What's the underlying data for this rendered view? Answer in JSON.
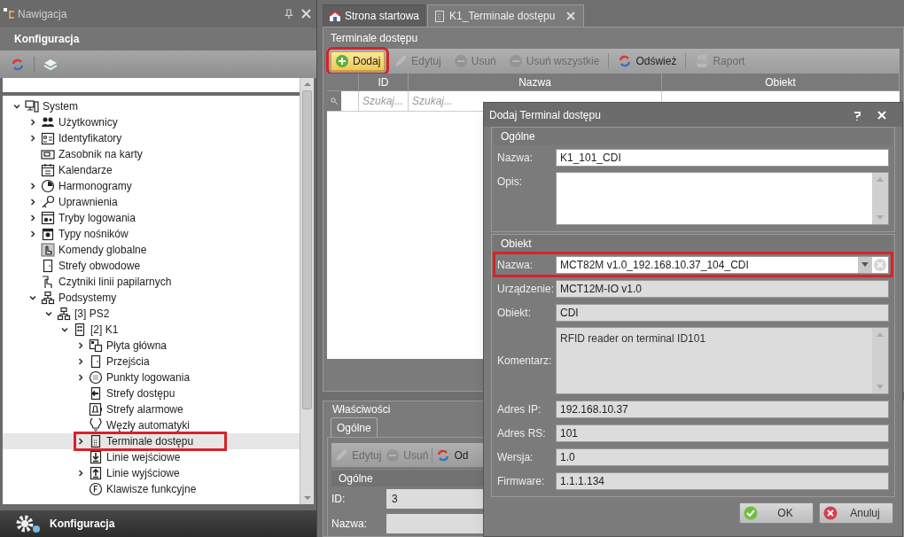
{
  "navigation": {
    "title": "Nawigacja",
    "section": "Konfiguracja",
    "tree": [
      {
        "label": "System",
        "expanded": true,
        "selected": false,
        "highlighted": false,
        "children": [
          {
            "label": "Użytkownicy",
            "expanded": false,
            "selected": false,
            "highlighted": false
          },
          {
            "label": "Identyfikatory",
            "expanded": false,
            "selected": false,
            "highlighted": false
          },
          {
            "label": "Zasobnik na karty",
            "selected": false,
            "highlighted": false
          },
          {
            "label": "Kalendarze",
            "selected": false,
            "highlighted": false
          },
          {
            "label": "Harmonogramy",
            "expanded": false,
            "selected": false,
            "highlighted": false
          },
          {
            "label": "Uprawnienia",
            "expanded": false,
            "selected": false,
            "highlighted": false
          },
          {
            "label": "Tryby logowania",
            "expanded": false,
            "selected": false,
            "highlighted": false
          },
          {
            "label": "Typy nośników",
            "expanded": false,
            "selected": false,
            "highlighted": false
          },
          {
            "label": "Komendy globalne",
            "selected": false,
            "highlighted": false
          },
          {
            "label": "Strefy obwodowe",
            "selected": false,
            "highlighted": false
          },
          {
            "label": "Czytniki linii papilarnych",
            "selected": false,
            "highlighted": false
          },
          {
            "label": "Podsystemy",
            "expanded": true,
            "selected": false,
            "highlighted": false,
            "children": [
              {
                "label": "[3] PS2",
                "expanded": true,
                "selected": false,
                "highlighted": false,
                "children": [
                  {
                    "label": "[2] K1",
                    "expanded": true,
                    "selected": false,
                    "highlighted": false,
                    "children": [
                      {
                        "label": "Płyta główna",
                        "expanded": false,
                        "selected": false,
                        "highlighted": false
                      },
                      {
                        "label": "Przejścia",
                        "expanded": false,
                        "selected": false,
                        "highlighted": false
                      },
                      {
                        "label": "Punkty logowania",
                        "expanded": false,
                        "selected": false,
                        "highlighted": false
                      },
                      {
                        "label": "Strefy dostępu",
                        "selected": false,
                        "highlighted": false
                      },
                      {
                        "label": "Strefy alarmowe",
                        "selected": false,
                        "highlighted": false
                      },
                      {
                        "label": "Węzły automatyki",
                        "selected": false,
                        "highlighted": false
                      },
                      {
                        "label": "Terminale dostępu",
                        "expanded": false,
                        "selected": true,
                        "highlighted": true
                      },
                      {
                        "label": "Linie wejściowe",
                        "selected": false,
                        "highlighted": false
                      },
                      {
                        "label": "Linie wyjściowe",
                        "expanded": false,
                        "selected": false,
                        "highlighted": false
                      },
                      {
                        "label": "Klawisze funkcyjne",
                        "selected": false,
                        "highlighted": false
                      }
                    ]
                  }
                ]
              }
            ]
          }
        ]
      }
    ],
    "footer": "Konfiguracja"
  },
  "tabs": [
    {
      "label": "Strona startowa",
      "selected": false,
      "closable": false
    },
    {
      "label": "K1_Terminale dostępu",
      "selected": true,
      "closable": true
    }
  ],
  "list_panel": {
    "title": "Terminale dostępu",
    "toolbar": [
      {
        "label": "Dodaj",
        "kind": "add",
        "disabled": false,
        "highlighted": true
      },
      {
        "label": "Edytuj",
        "kind": "edit",
        "disabled": true,
        "highlighted": false
      },
      {
        "label": "Usuń",
        "kind": "remove",
        "disabled": true,
        "highlighted": false
      },
      {
        "label": "Usuń wszystkie",
        "kind": "remove",
        "disabled": true,
        "highlighted": false
      },
      {
        "label": "Odśwież",
        "kind": "refresh",
        "disabled": false,
        "highlighted": false
      },
      {
        "label": "Raport",
        "kind": "report",
        "disabled": true,
        "highlighted": false
      }
    ],
    "columns": [
      "ID",
      "Nazwa",
      "Obiekt"
    ],
    "search_placeholders": [
      "Szukaj...",
      "Szukaj..."
    ]
  },
  "properties_panel": {
    "title": "Właściwości",
    "tabs": [
      {
        "label": "Ogólne",
        "selected": true
      }
    ],
    "toolbar": [
      {
        "label": "Edytuj",
        "kind": "edit",
        "disabled": true
      },
      {
        "label": "Usuń",
        "kind": "remove",
        "disabled": true
      },
      {
        "label": "Od",
        "kind": "refresh",
        "disabled": false
      }
    ],
    "group": "Ogólne",
    "fields": [
      {
        "label": "ID:",
        "value": "3"
      },
      {
        "label": "Nazwa:"
      }
    ]
  },
  "dialog": {
    "title": "Dodaj Terminal dostępu",
    "groups": [
      {
        "title": "Ogólne",
        "fields": [
          {
            "label": "Nazwa:",
            "kind": "text",
            "value": "K1_101_CDI",
            "readonly": false,
            "highlighted": false
          },
          {
            "label": "Opis:",
            "kind": "textarea",
            "readonly": false,
            "highlighted": false
          }
        ]
      },
      {
        "title": "Obiekt",
        "fields": [
          {
            "label": "Nazwa:",
            "kind": "combo",
            "value": "MCT82M v1.0_192.168.10.37_104_CDI",
            "readonly": false,
            "highlighted": true
          },
          {
            "label": "Urządzenie:",
            "kind": "text",
            "value": "MCT12M-IO v1.0",
            "readonly": true,
            "highlighted": false
          },
          {
            "label": "Obiekt:",
            "kind": "text",
            "value": "CDI",
            "readonly": true,
            "highlighted": false
          },
          {
            "label": "Komentarz:",
            "kind": "textarea",
            "value": "RFID reader on terminal ID101",
            "readonly": true,
            "highlighted": false
          },
          {
            "label": "Adres IP:",
            "kind": "text",
            "value": "192.168.10.37",
            "readonly": true,
            "highlighted": false
          },
          {
            "label": "Adres RS:",
            "kind": "text",
            "value": "101",
            "readonly": true,
            "highlighted": false
          },
          {
            "label": "Wersja:",
            "kind": "text",
            "value": "1.0",
            "readonly": true,
            "highlighted": false
          },
          {
            "label": "Firmware:",
            "kind": "text",
            "value": "1.1.1.134",
            "readonly": true,
            "highlighted": false
          }
        ]
      }
    ],
    "buttons": [
      {
        "label": "OK",
        "kind": "ok"
      },
      {
        "label": "Anuluj",
        "kind": "cancel"
      }
    ]
  }
}
